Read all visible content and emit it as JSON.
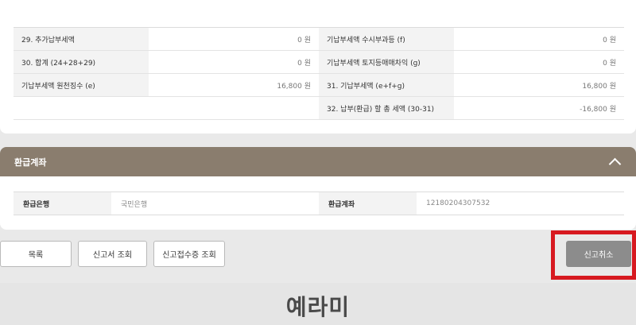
{
  "tax_rows": [
    {
      "left_label": "29. 추가납부세액",
      "left_value": "0 원",
      "right_label": "기납부세액 수시부과등 (f)",
      "right_value": "0 원"
    },
    {
      "left_label": "30. 합계 (24+28+29)",
      "left_value": "0 원",
      "right_label": "기납부세액 토지등매매차익 (g)",
      "right_value": "0 원"
    },
    {
      "left_label": "기납부세액 원천징수 (e)",
      "left_value": "16,800 원",
      "right_label": "31. 기납부세액 (e+f+g)",
      "right_value": "16,800 원"
    },
    {
      "left_label": "",
      "left_value": "",
      "right_label": "32. 납부(환급) 할 총 세액 (30-31)",
      "right_value": "-16,800 원"
    }
  ],
  "refund": {
    "title": "환급계좌",
    "bank_label": "환급은행",
    "bank_value": "국민은행",
    "account_label": "환급계좌",
    "account_value": "12180204307532"
  },
  "buttons": {
    "list": "목록",
    "view_report": "신고서 조회",
    "view_receipt": "신고접수증 조회",
    "cancel": "신고취소"
  },
  "watermark": "예라미",
  "colors": {
    "section_header": "#8a7d6e",
    "highlight": "#d71920",
    "cancel_button": "#8c8c8c"
  }
}
